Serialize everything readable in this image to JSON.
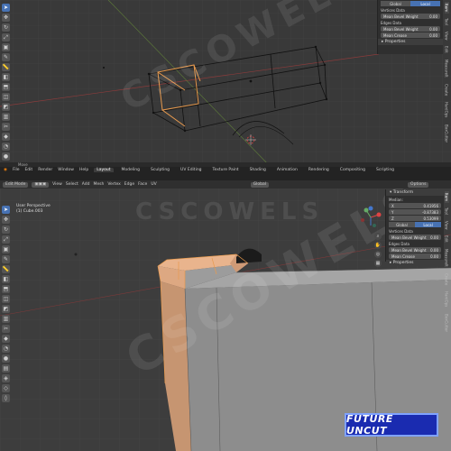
{
  "top_view": {
    "toolbar_icons": [
      "cursor-icon",
      "move-icon",
      "rotate-icon",
      "scale-icon",
      "transform-icon",
      "annotate-icon",
      "measure-icon",
      "add-cube-icon",
      "extrude-icon",
      "inset-icon",
      "bevel-icon",
      "loopcut-icon",
      "knife-icon",
      "polybuild-icon",
      "spin-icon",
      "smooth-icon",
      "edgeslide-icon",
      "shrink-icon",
      "shear-icon",
      "rip-icon"
    ],
    "sidebar": {
      "seg_global": "Global",
      "seg_local": "Local",
      "vertices_data": "Vertices Data",
      "mean_bevel_weight_v": "Mean Bevel Weight",
      "mean_bevel_weight_v_val": "0.00",
      "edges_data": "Edges Data",
      "mean_bevel_weight_e": "Mean Bevel Weight",
      "mean_bevel_weight_e_val": "0.00",
      "mean_crease": "Mean Crease",
      "mean_crease_val": "0.00",
      "properties": "Properties"
    },
    "tabs": [
      "Item",
      "Tool",
      "View",
      "Edit",
      "MeasureIt",
      "Create",
      "HardOps",
      "BoxCutter"
    ],
    "status": "Move"
  },
  "menu": {
    "items": [
      "File",
      "Edit",
      "Render",
      "Window",
      "Help"
    ],
    "workspaces": [
      "Layout",
      "Modeling",
      "Sculpting",
      "UV Editing",
      "Texture Paint",
      "Shading",
      "Animation",
      "Rendering",
      "Compositing",
      "Scripting"
    ],
    "active_workspace": "Layout"
  },
  "bottom_view": {
    "mode": "Edit Mode",
    "header_items": [
      "View",
      "Select",
      "Add",
      "Mesh",
      "Vertex",
      "Edge",
      "Face",
      "UV"
    ],
    "orientation": "Global",
    "options": "Options",
    "perspective": "User Perspective",
    "object": "(1) Cube.003",
    "sidebar": {
      "transform": "Transform",
      "median": "Median:",
      "x_label": "X",
      "x_val": "0.41956",
      "y_label": "Y",
      "y_val": "-0.87383",
      "z_label": "Z",
      "z_val": "0.53099",
      "seg_global": "Global",
      "seg_local": "Local",
      "vertices_data": "Vertices Data",
      "mean_bevel_weight_v": "Mean Bevel Weight",
      "mean_bevel_weight_v_val": "0.00",
      "edges_data": "Edges Data",
      "mean_bevel_weight_e": "Mean Bevel Weight",
      "mean_bevel_weight_e_val": "0.00",
      "mean_crease": "Mean Crease",
      "mean_crease_val": "0.00",
      "properties": "Properties"
    },
    "tabs": [
      "Item",
      "Tool",
      "View",
      "Edit",
      "MeasureIt",
      "Create",
      "HardOps",
      "BoxCutter"
    ]
  },
  "watermark": "CSCOWELS",
  "logo_text": "FUTURE UNCUT",
  "colors": {
    "accent": "#4772b3",
    "selection": "#e89a4e",
    "mesh": "#9a9a9a",
    "logo_bg": "#1a2bb0"
  }
}
